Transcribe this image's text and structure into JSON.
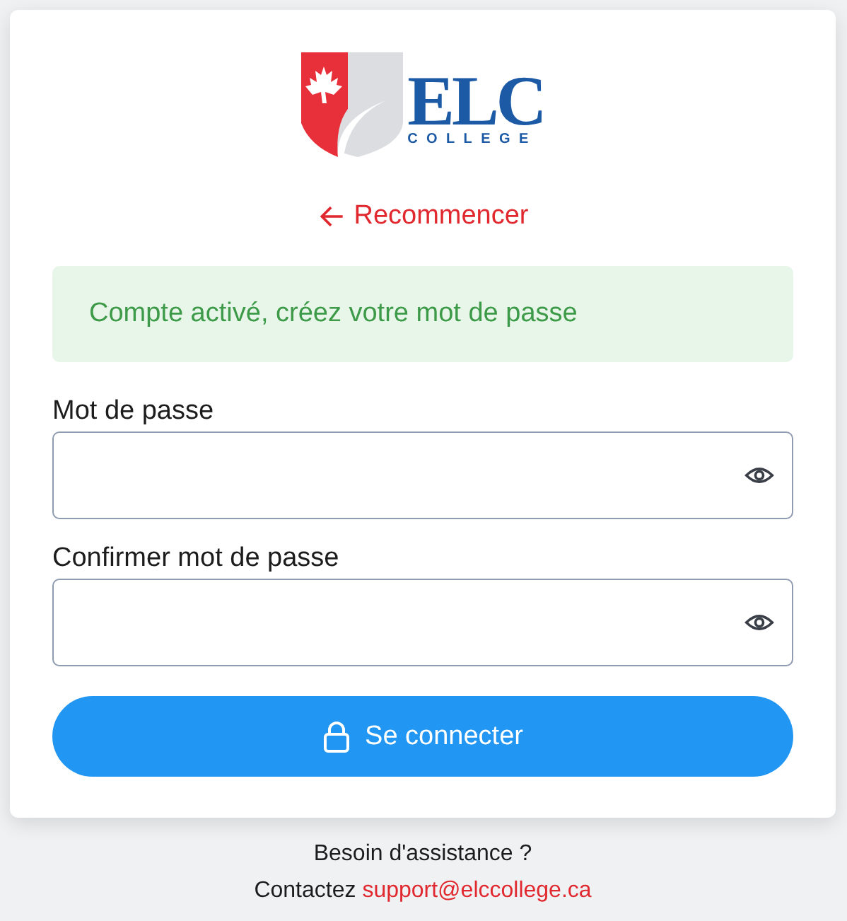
{
  "logo": {
    "name": "ELC",
    "subtitle": "COLLEGE"
  },
  "back_link": {
    "label": "Recommencer"
  },
  "alert": {
    "text": "Compte activé, créez votre mot de passe"
  },
  "fields": [
    {
      "label": "Mot de passe"
    },
    {
      "label": "Confirmer mot de passe"
    }
  ],
  "submit": {
    "label": "Se connecter"
  },
  "footer": {
    "help": "Besoin d'assistance ?",
    "contact_prefix": "Contactez",
    "email": "support@elccollege.ca"
  }
}
